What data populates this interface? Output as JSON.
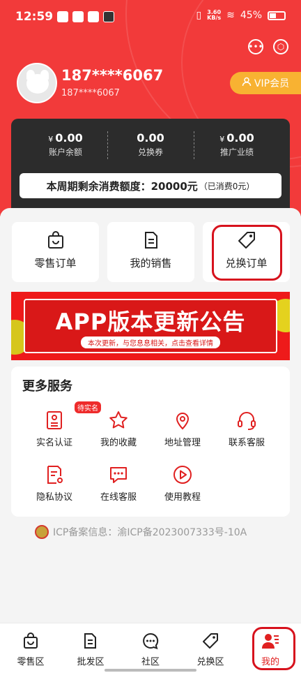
{
  "status_bar": {
    "time": "12:59",
    "net_speed": "3.60",
    "net_unit": "KB/s",
    "battery": "45%"
  },
  "profile": {
    "name": "187****6067",
    "phone": "187****6067",
    "vip_label": "VIP会员"
  },
  "wallet": {
    "balance": {
      "currency": "¥",
      "value": "0.00",
      "label": "账户余额"
    },
    "coupons": {
      "value": "0.00",
      "label": "兑换券"
    },
    "performance": {
      "currency": "¥",
      "value": "0.00",
      "label": "推广业绩"
    },
    "quota_text": "本周期剩余消费额度：20000元",
    "quota_note": "（已消费0元）"
  },
  "orders": [
    {
      "label": "零售订单",
      "icon": "shopping-bag-icon"
    },
    {
      "label": "我的销售",
      "icon": "document-icon"
    },
    {
      "label": "兑换订单",
      "icon": "tag-icon"
    }
  ],
  "banner": {
    "title": "APP版本更新公告",
    "subtitle": "本次更新，与您息息相关，点击查看详情"
  },
  "services": {
    "heading": "更多服务",
    "items": [
      {
        "label": "实名认证",
        "icon": "id-card-icon",
        "badge": "待实名"
      },
      {
        "label": "我的收藏",
        "icon": "star-icon"
      },
      {
        "label": "地址管理",
        "icon": "location-icon"
      },
      {
        "label": "联系客服",
        "icon": "headset-icon"
      },
      {
        "label": "隐私协议",
        "icon": "privacy-doc-icon"
      },
      {
        "label": "在线客服",
        "icon": "chat-icon"
      },
      {
        "label": "使用教程",
        "icon": "play-icon"
      }
    ]
  },
  "icp": "ICP备案信息：渝ICP备2023007333号-10A",
  "tabs": [
    {
      "label": "零售区",
      "icon": "shopping-bag-icon"
    },
    {
      "label": "批发区",
      "icon": "document-icon"
    },
    {
      "label": "社区",
      "icon": "chat-bubble-icon"
    },
    {
      "label": "兑换区",
      "icon": "tag-icon"
    },
    {
      "label": "我的",
      "icon": "user-icon",
      "active": true
    }
  ],
  "colors": {
    "primary": "#f23a3a",
    "accent_red": "#d7121d",
    "vip_orange": "#f8b232",
    "dark_card": "#2c2c2c"
  }
}
